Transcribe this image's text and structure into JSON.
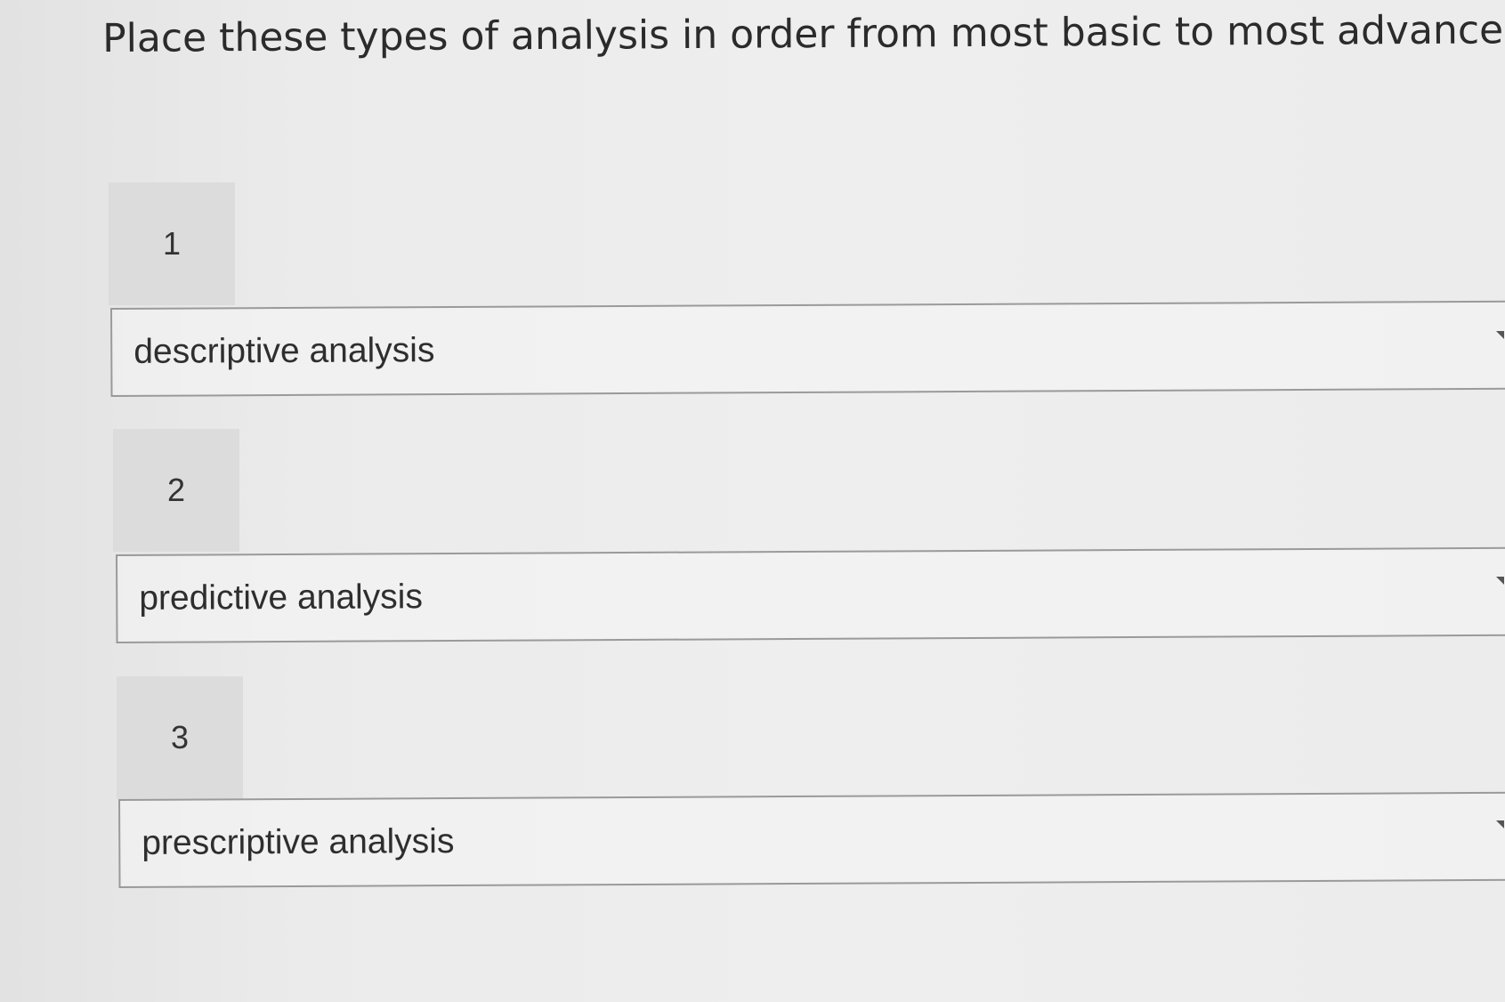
{
  "question": "Place these types of analysis in order from most basic to most advanced.",
  "items": [
    {
      "rank": "1",
      "answer": "descriptive analysis"
    },
    {
      "rank": "2",
      "answer": "predictive analysis"
    },
    {
      "rank": "3",
      "answer": "prescriptive analysis"
    }
  ],
  "icons": {
    "dropdown": "chevron-down-icon"
  }
}
